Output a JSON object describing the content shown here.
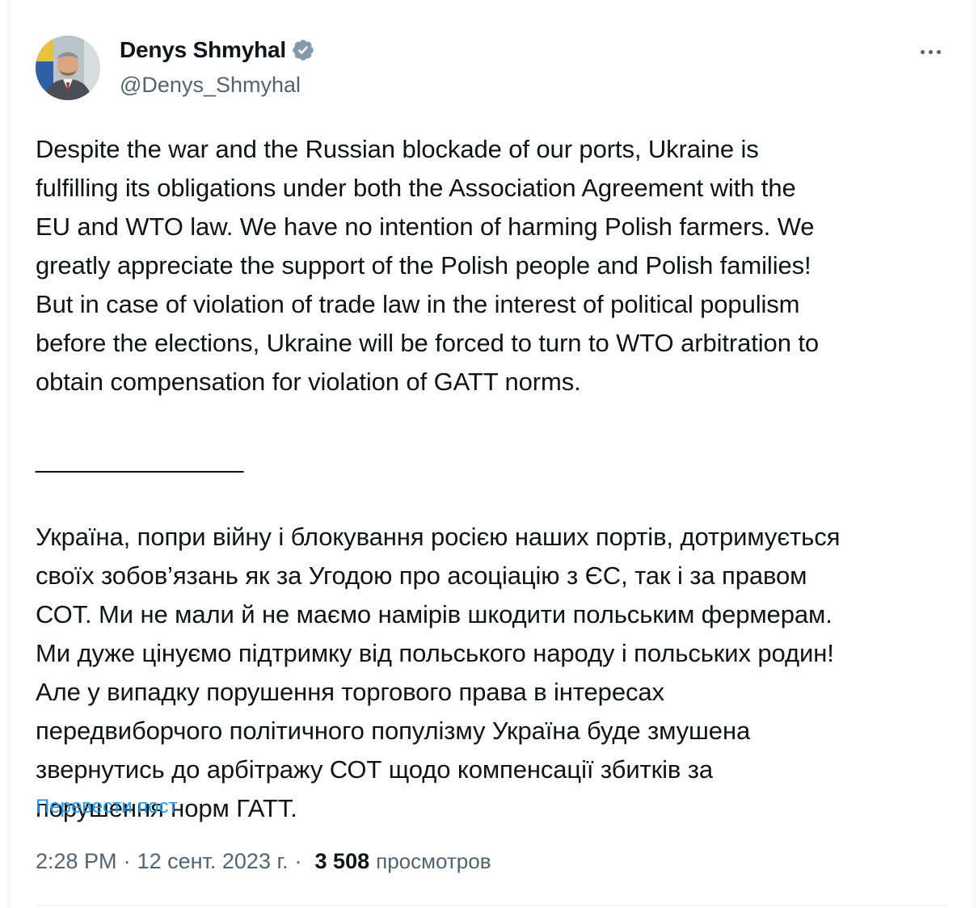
{
  "author": {
    "display_name": "Denys Shmyhal",
    "handle": "@Denys_Shmyhal",
    "avatar_icon": "profile-photo",
    "verified_icon": "verified-badge-icon"
  },
  "post": {
    "text": "Despite the war and the Russian blockade of our ports, Ukraine is\nfulfilling its obligations under both the Association Agreement with the\nEU and WTO law. We have no intention of harming Polish farmers. We\ngreatly appreciate the support of the Polish people and Polish families!\nBut in case of violation of trade law in the interest of political populism\nbefore the elections, Ukraine will be forced to turn to WTO arbitration to\nobtain compensation for violation of GATT norms.\n\n_______________\n\nУкраїна, попри війну і блокування росією наших портів, дотримується\nсвоїх зобов’язань як за Угодою про асоціацію з ЄС, так і за правом\nСОТ. Ми не мали й не маємо намірів шкодити польським фермерам.\nМи дуже цінуємо підтримку від польського народу і польських родин!\nАле у випадку порушення торгового права в інтересах\nпередвиборчого політичного популізму Україна буде змушена\nзвернутись до арбітражу СОТ щодо компенсації збитків за\nпорушення норм ГАТТ.",
    "translate_link": "Перевести пост"
  },
  "meta": {
    "time": "2:28 PM",
    "separator": "·",
    "date": "12 сент. 2023 г.",
    "views_count": "3 508",
    "views_label": "просмотров"
  },
  "colors": {
    "text": "#0f1419",
    "secondary": "#536471",
    "link": "#1d9bf0",
    "verified": "#829aab"
  }
}
